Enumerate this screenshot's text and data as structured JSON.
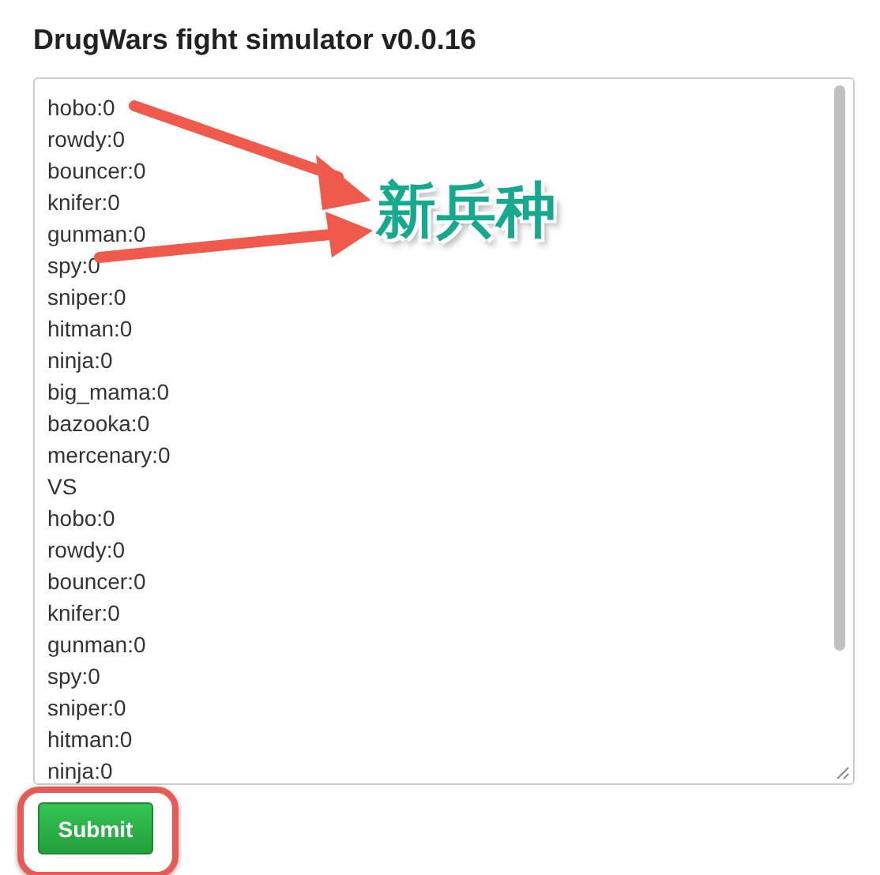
{
  "title": "DrugWars fight simulator v0.0.16",
  "textarea": {
    "lines": [
      "hobo:0",
      "rowdy:0",
      "bouncer:0",
      "knifer:0",
      "gunman:0",
      "spy:0",
      "sniper:0",
      "hitman:0",
      "ninja:0",
      "big_mama:0",
      "bazooka:0",
      "mercenary:0",
      "VS",
      "hobo:0",
      "rowdy:0",
      "bouncer:0",
      "knifer:0",
      "gunman:0",
      "spy:0",
      "sniper:0",
      "hitman:0",
      "ninja:0"
    ]
  },
  "submit": {
    "label": "Submit"
  },
  "annotation": {
    "label": "新兵种"
  }
}
